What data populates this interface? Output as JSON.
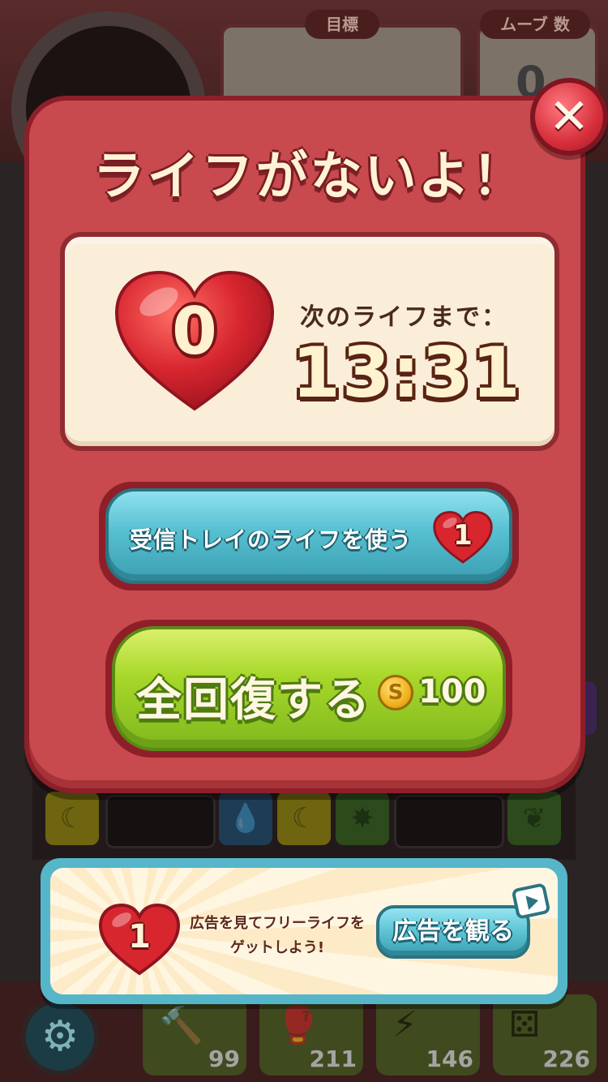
{
  "background": {
    "goal_label": "目標",
    "moves_label": "ムーブ 数",
    "moves_count": "0",
    "boosters": [
      {
        "icon": "hammer-icon",
        "count": "99"
      },
      {
        "icon": "boxing-glove-icon",
        "count": "211"
      },
      {
        "icon": "lightning-icon",
        "count": "146"
      },
      {
        "icon": "dice-icon",
        "count": "226"
      }
    ]
  },
  "dialog": {
    "title": "ライフがないよ！",
    "close_symbol": "✕",
    "lives_count": "0",
    "next_life_label": "次のライフまで：",
    "timer": "13:31",
    "inbox_button_label": "受信トレイのライフを使う",
    "inbox_lives_count": "1",
    "refill_button_label": "全回復する",
    "refill_cost": "100",
    "coin_symbol": "S"
  },
  "ad": {
    "lives_count": "1",
    "text_line1": "広告を見てフリーライフを",
    "text_line2": "ゲットしよう!",
    "button_label": "広告を観る"
  },
  "colors": {
    "dialog_red": "#c84a4e",
    "panel_cream": "#faeed9",
    "inbox_blue": "#56bfd0",
    "refill_green": "#a8d72a",
    "heart_red": "#d8262f"
  }
}
